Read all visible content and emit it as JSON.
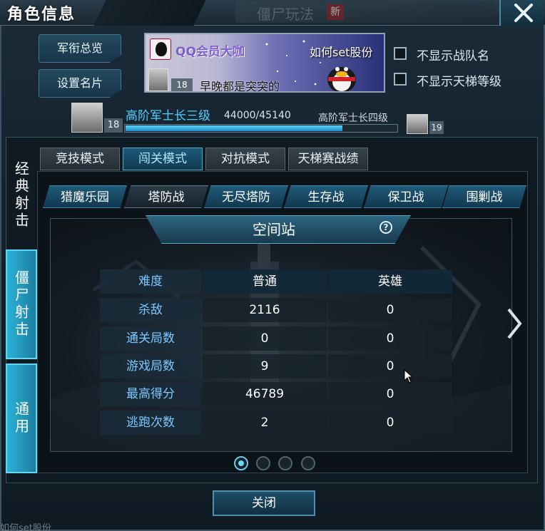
{
  "window": {
    "title": "角色信息",
    "background_tab": "僵尸玩法",
    "background_badge": "新",
    "background_text": "如何set股份"
  },
  "left_buttons": {
    "overview": "军衔总览",
    "namecard": "设置名片"
  },
  "banner": {
    "vip_text": "QQ会员大咖",
    "caption": "如何set股份",
    "level": "18",
    "motto": "早晚都是突突的"
  },
  "options": {
    "hide_team_name": "不显示战队名",
    "hide_ladder_level": "不显示天梯等级"
  },
  "rank": {
    "current_name": "高阶军士长三级",
    "current_level": "18",
    "xp_text": "44000/45140",
    "xp_fraction": 0.8,
    "next_name": "高阶军士长四级",
    "next_level": "19"
  },
  "side_tabs": [
    "经典射击",
    "僵尸射击",
    "通用"
  ],
  "mode_tabs": [
    "竞技模式",
    "闯关模式",
    "对抗模式",
    "天梯赛战绩"
  ],
  "active_mode": 1,
  "sub_tabs": [
    "猎魔乐园",
    "塔防战",
    "无尽塔防",
    "生存战",
    "保卫战",
    "围剿战"
  ],
  "active_sub_tab": 1,
  "stage": {
    "title": "空间站",
    "help": "?"
  },
  "stats": {
    "headers": [
      "难度",
      "普通",
      "英雄"
    ],
    "rows": [
      [
        "杀敌",
        "2116",
        "0"
      ],
      [
        "通关局数",
        "0",
        "0"
      ],
      [
        "游戏局数",
        "9",
        "0"
      ],
      [
        "最高得分",
        "46789",
        "0"
      ],
      [
        "逃跑次数",
        "2",
        "0"
      ]
    ]
  },
  "pager": {
    "count": 4,
    "active": 0
  },
  "close_button": "关闭",
  "colors": {
    "accent": "#2bb2d6",
    "rank_name": "#4fd0ff",
    "stat_label": "#7cc8ff"
  },
  "icons": [
    "close-icon",
    "rank-icon",
    "help-icon",
    "chevron-right-icon",
    "penguin-icon"
  ]
}
